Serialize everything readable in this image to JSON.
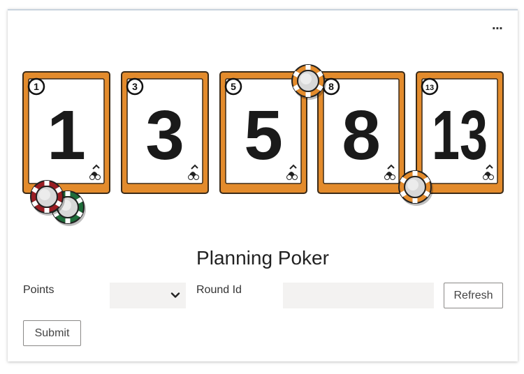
{
  "menu": {
    "more_label": "···"
  },
  "cards": [
    {
      "value": "1"
    },
    {
      "value": "3"
    },
    {
      "value": "5"
    },
    {
      "value": "8"
    },
    {
      "value": "13"
    }
  ],
  "title": "Planning Poker",
  "form": {
    "points_label": "Points",
    "points_value": "",
    "round_label": "Round Id",
    "round_value": "",
    "refresh_label": "Refresh",
    "submit_label": "Submit"
  },
  "colors": {
    "card_frame": "#e38b2c",
    "chip_red": "#9a1d23",
    "chip_green": "#1e6d3a",
    "chip_orange": "#e38b2c"
  }
}
